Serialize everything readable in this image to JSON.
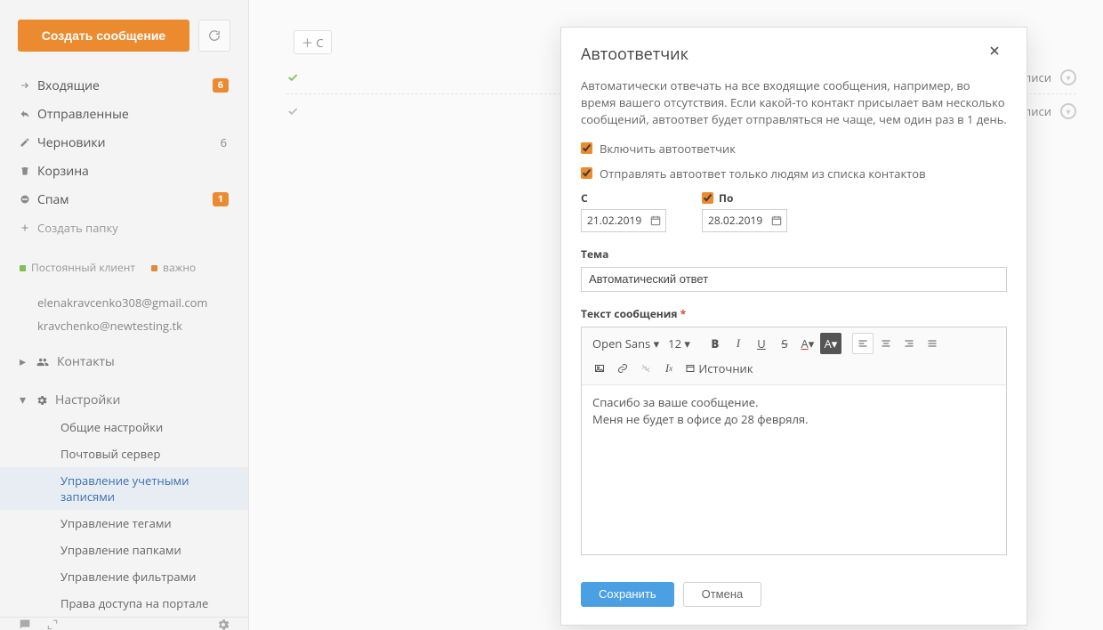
{
  "sidebar": {
    "compose": "Создать сообщение",
    "nav": {
      "inbox": {
        "label": "Входящие",
        "badge": "6"
      },
      "sent": {
        "label": "Отправленные"
      },
      "drafts": {
        "label": "Черновики",
        "count": "6"
      },
      "trash": {
        "label": "Корзина"
      },
      "spam": {
        "label": "Спам",
        "badge": "1"
      },
      "create_folder": "Создать папку"
    },
    "tags": {
      "permanent": "Постоянный клиент",
      "important": "важно"
    },
    "accounts": [
      "elenakravcenko308@gmail.com",
      "kravchenko@newtesting.tk"
    ],
    "contacts_label": "Контакты",
    "settings_label": "Настройки",
    "settings_items": {
      "general": "Общие настройки",
      "mailserver": "Почтовый сервер",
      "accounts": "Управление учетными записями",
      "tags": "Управление тегами",
      "folders": "Управление папками",
      "filters": "Управление фильтрами",
      "portal": "Права доступа на портале"
    }
  },
  "main": {
    "add_placeholder": "С",
    "signature_label": "Настройка подписи"
  },
  "modal": {
    "title": "Автоответчик",
    "description": "Автоматически отвечать на все входящие сообщения, например, во время вашего отсутствия. Если какой-то контакт присылает вам несколько сообщений, автоответ будет отправляться не чаще, чем один раз в 1 день.",
    "enable_label": "Включить автоответчик",
    "contacts_only_label": "Отправлять автоответ только людям из списка контактов",
    "from_label": "С",
    "to_label": "По",
    "from_value": "21.02.2019",
    "to_value": "28.02.2019",
    "subject_label": "Тема",
    "subject_value": "Автоматический ответ",
    "body_label": "Текст сообщения",
    "toolbar": {
      "font": "Open Sans",
      "size": "12",
      "source": "Источник"
    },
    "body_line1": "Спасибо за ваше сообщение.",
    "body_line2": "Меня не будет в офисе до 28 февряля.",
    "save": "Сохранить",
    "cancel": "Отмена"
  }
}
